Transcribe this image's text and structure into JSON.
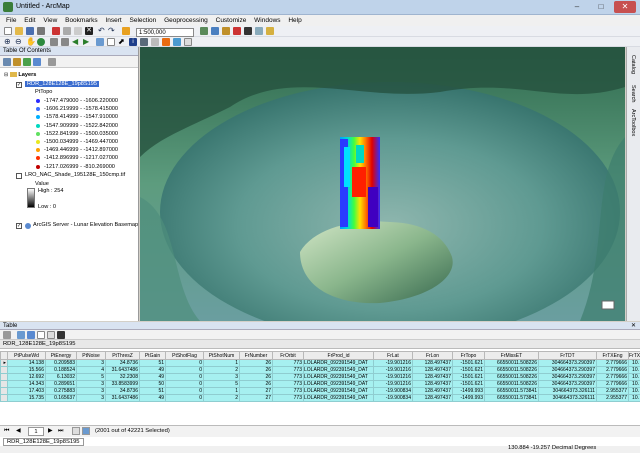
{
  "window": {
    "title": "Untitled - ArcMap"
  },
  "menu": [
    "File",
    "Edit",
    "View",
    "Bookmarks",
    "Insert",
    "Selection",
    "Geoprocessing",
    "Customize",
    "Windows",
    "Help"
  ],
  "toolbar": {
    "scale": "1:500,000"
  },
  "toc": {
    "title": "Table Of Contents",
    "layers_label": "Layers",
    "layer1": {
      "name": "RDR_128E128E_19p8S195",
      "field": "PtTopo"
    },
    "classes": [
      {
        "label": "-1747.479000 - -1606.220000",
        "color": "#2a2aff"
      },
      {
        "label": "-1606.219999 - -1578.415000",
        "color": "#3b6dff"
      },
      {
        "label": "-1578.414999 - -1547.910000",
        "color": "#00b0ff"
      },
      {
        "label": "-1547.909999 - -1522.842000",
        "color": "#00d8c0"
      },
      {
        "label": "-1522.841999 - -1500.035000",
        "color": "#60e060"
      },
      {
        "label": "-1500.034999 - -1469.447000",
        "color": "#e8e820"
      },
      {
        "label": "-1469.446999 - -1412.897000",
        "color": "#ffa000"
      },
      {
        "label": "-1412.896999 - -1217.027000",
        "color": "#ff3000"
      },
      {
        "label": "-1217.026999 - -810.269000",
        "color": "#c00000"
      }
    ],
    "layer2": {
      "name": "LRO_NAC_Shade_195128E_150cmp.tif",
      "value": "Value",
      "high": "High : 254",
      "low": "Low : 0"
    },
    "layer3": {
      "name": "ArcGIS Server - Lunar Elevation Basemap"
    }
  },
  "right_tabs": [
    "Catalog",
    "Search",
    "ArcToolbox"
  ],
  "table": {
    "title": "Table",
    "name": "RDR_128E128E_19p8S195",
    "columns": [
      "PtPulseWd",
      "PtEnergy",
      "PtNoise",
      "PtThresZ",
      "PtGain",
      "PtShotFlag",
      "PtShotNum",
      "FrNumber",
      "FrOrbit",
      "FrProd_id",
      "FrLat",
      "FrLon",
      "FrTopo",
      "FrMissET",
      "FrTDT",
      "FrTXEng",
      "FrTXP"
    ],
    "rows": [
      [
        "14.138",
        "0.209583",
        "3",
        "34.8736",
        "51",
        "0",
        "1",
        "26",
        "773",
        "LOLARDR_092391549_DAT",
        "-19.901216",
        "128.497437",
        "-1501.621",
        "66550011.508226",
        "304664373.290397",
        "2.779666",
        "10."
      ],
      [
        "15.566",
        "0.188524",
        "4",
        "31.6437486",
        "49",
        "0",
        "2",
        "26",
        "773",
        "LOLARDR_092391549_DAT",
        "-19.901216",
        "128.497437",
        "-1501.621",
        "66550011.508226",
        "304664373.290397",
        "2.779666",
        "10."
      ],
      [
        "12.692",
        "6.13032",
        "5",
        "32.2308",
        "49",
        "0",
        "3",
        "26",
        "773",
        "LOLARDR_092391549_DAT",
        "-19.901216",
        "128.497437",
        "-1501.621",
        "66550011.508226",
        "304664373.290397",
        "2.779666",
        "10."
      ],
      [
        "14.343",
        "0.289651",
        "3",
        "33.8583999",
        "50",
        "0",
        "5",
        "26",
        "773",
        "LOLARDR_092391549_DAT",
        "-19.901216",
        "128.497437",
        "-1501.621",
        "66550011.508226",
        "304664373.290397",
        "2.779666",
        "10."
      ],
      [
        "17.403",
        "0.275883",
        "3",
        "34.8736",
        "51",
        "0",
        "1",
        "27",
        "773",
        "LOLARDR_092391549_DAT",
        "-19.900834",
        "128.497437",
        "-1499.993",
        "66550011.573841",
        "304664373.326111",
        "2.955377",
        "10."
      ],
      [
        "15.735",
        "0.165637",
        "3",
        "31.6437486",
        "49",
        "0",
        "2",
        "27",
        "773",
        "LOLARDR_092391549_DAT",
        "-19.900834",
        "128.497437",
        "-1499.993",
        "66550011.573841",
        "304664373.326111",
        "2.955377",
        "10."
      ]
    ],
    "nav": {
      "page": "1",
      "selection": "(2001 out of 42221 Selected)"
    },
    "tab_label": "RDR_128E128E_19p8S195"
  },
  "status": {
    "coords": "130.884  -19.257 Decimal Degrees"
  }
}
